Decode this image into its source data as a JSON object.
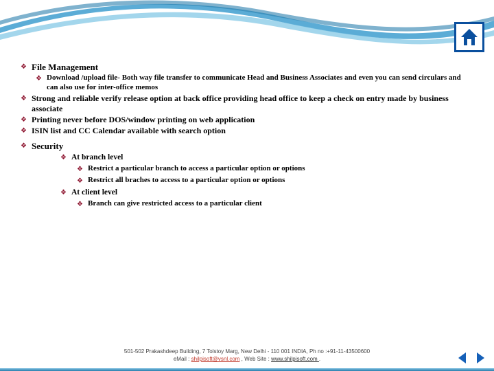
{
  "headings": {
    "file_management": "File Management",
    "security": "Security"
  },
  "file_mgmt": {
    "sub1": "Download /upload file- Both way file transfer to communicate Head and Business Associates and even you can send circulars and can also use for inter-office memos",
    "item2": "Strong and reliable verify release option at back office providing head office to keep a check on entry made by business associate",
    "item3": "Printing never before DOS/window printing on web application",
    "item4": "ISIN list and CC Calendar available with search option"
  },
  "security": {
    "branch_level": "At  branch level",
    "branch_r1": "Restrict a particular branch to access a particular option or options",
    "branch_r2": "Restrict all braches to access to a particular option or options",
    "client_level": "At client level",
    "client_r1": "Branch can give restricted access to a particular client"
  },
  "footer": {
    "line1_pre": "501-502 Prakashdeep Building, 7 Tolstoy Marg, New Delhi - 110 001 INDIA,  Ph no :+91-11-43500600",
    "line2_pre": "eMail : ",
    "email": "shilpisoft@vsnl.com",
    "line2_mid": " , Web Site : ",
    "website": " www.shilpisoft.com ",
    "tail": "."
  }
}
